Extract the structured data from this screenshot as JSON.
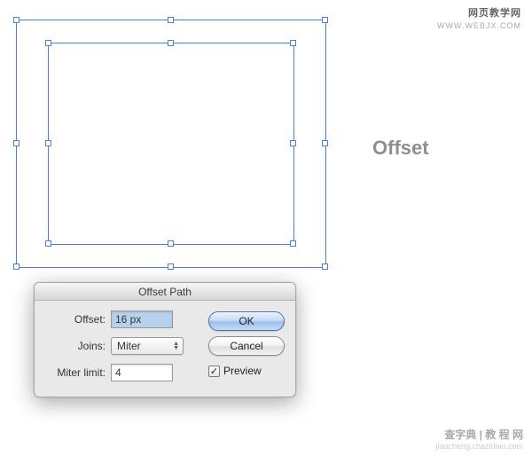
{
  "watermark_tr": {
    "line1": "网页教学网",
    "line2": "WWW.WEBJX.COM"
  },
  "watermark_br": {
    "line1": "查字典 | 教 程 网",
    "line2": "jiaocheng.chazidian.com"
  },
  "big_label": "Offset",
  "dialog": {
    "title": "Offset Path",
    "offset_label": "Offset:",
    "offset_value": "16 px",
    "joins_label": "Joins:",
    "joins_value": "Miter",
    "miter_label": "Miter limit:",
    "miter_value": "4",
    "ok": "OK",
    "cancel": "Cancel",
    "preview": "Preview",
    "preview_checked": "✓"
  }
}
